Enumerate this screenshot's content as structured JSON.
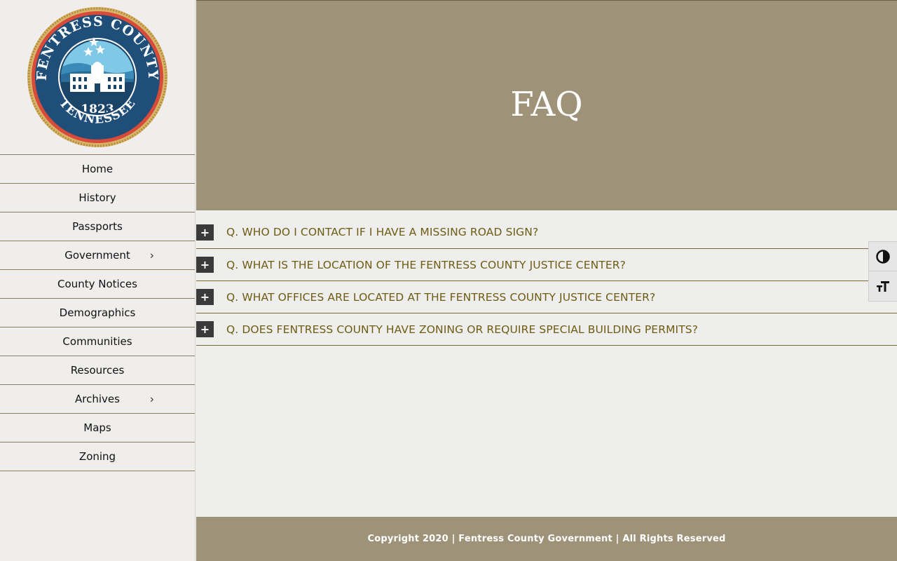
{
  "site": {
    "seal_text_top": "FENTRESS COUNTY",
    "seal_text_bottom": "TENNESSEE",
    "seal_year": "1823"
  },
  "nav": {
    "items": [
      {
        "label": "Home",
        "has_submenu": false
      },
      {
        "label": "History",
        "has_submenu": false
      },
      {
        "label": "Passports",
        "has_submenu": false
      },
      {
        "label": "Government",
        "has_submenu": true
      },
      {
        "label": "County Notices",
        "has_submenu": false
      },
      {
        "label": "Demographics",
        "has_submenu": false
      },
      {
        "label": "Communities",
        "has_submenu": false
      },
      {
        "label": "Resources",
        "has_submenu": false
      },
      {
        "label": "Archives",
        "has_submenu": true
      },
      {
        "label": "Maps",
        "has_submenu": false
      },
      {
        "label": "Zoning",
        "has_submenu": false
      }
    ],
    "submenu_glyph": "›"
  },
  "hero": {
    "title": "FAQ"
  },
  "faq": {
    "toggle_glyph": "+",
    "items": [
      {
        "question": "Q. WHO DO I CONTACT IF I HAVE A MISSING ROAD SIGN?"
      },
      {
        "question": "Q. WHAT IS THE LOCATION OF THE FENTRESS COUNTY JUSTICE CENTER?"
      },
      {
        "question": "Q. WHAT OFFICES ARE LOCATED AT THE FENTRESS COUNTY JUSTICE CENTER?"
      },
      {
        "question": "Q. DOES FENTRESS COUNTY HAVE ZONING OR REQUIRE SPECIAL BUILDING PERMITS?"
      }
    ]
  },
  "footer": {
    "text": "Copyright 2020 | Fentress County Government | All Rights Reserved"
  },
  "a11y": {
    "buttons": [
      {
        "icon": "contrast-icon"
      },
      {
        "icon": "font-size-icon"
      }
    ]
  },
  "colors": {
    "accent": "#9e9378",
    "question_text": "#6f5c14",
    "toggle_bg": "#3a3a3a",
    "divider": "#8e7d5f"
  }
}
